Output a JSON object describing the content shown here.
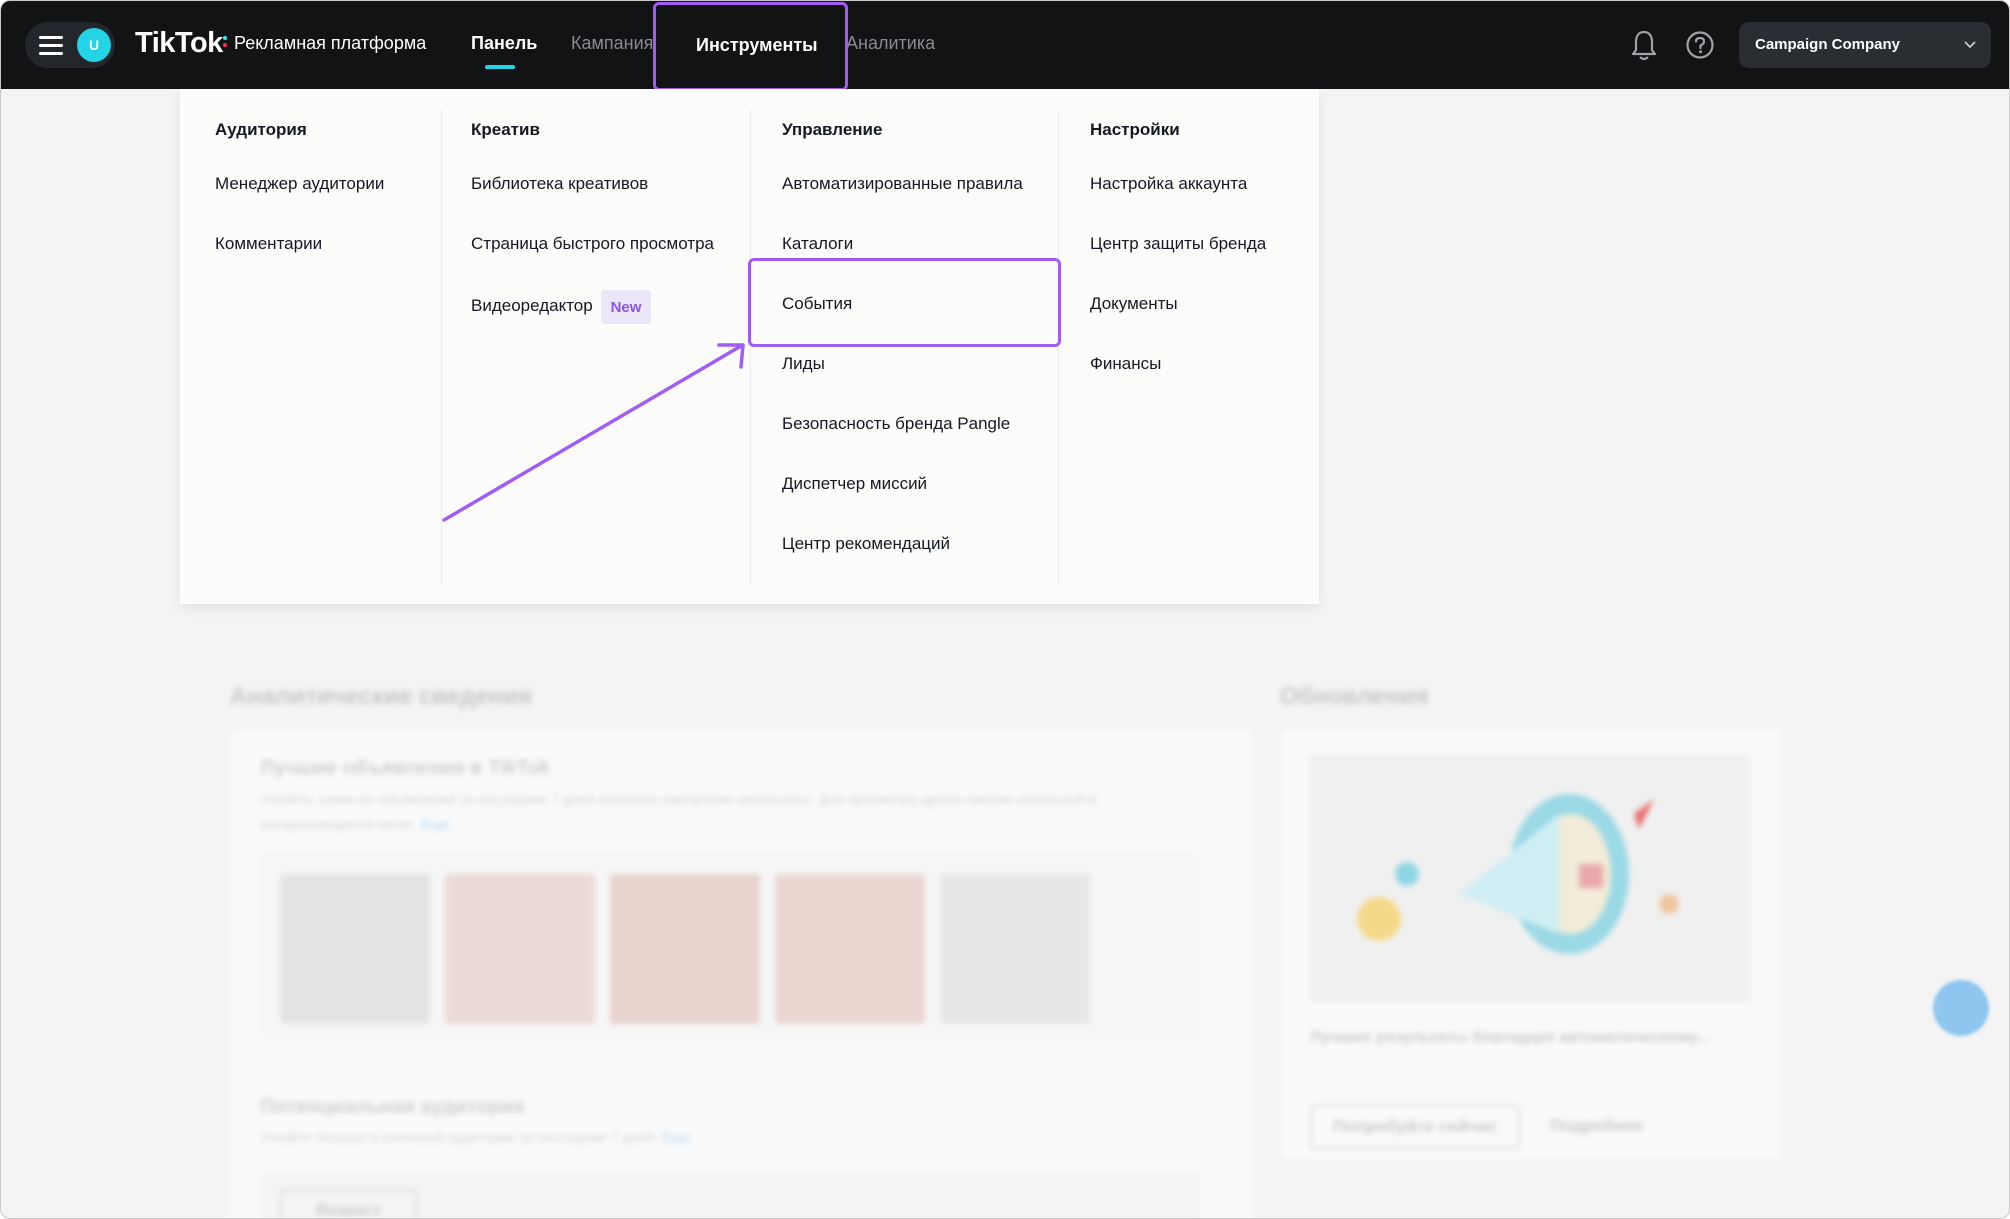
{
  "topbar": {
    "avatar_letter": "U",
    "logo": "TikTok",
    "logo_sub": "Рекламная платформа",
    "nav": [
      "Панель",
      "Кампания",
      "Инструменты",
      "Аналитика"
    ],
    "company": "Campaign Company",
    "accent": "#25d3e6",
    "highlight": "#a15cf5"
  },
  "menu": {
    "columns": [
      {
        "title": "Аудитория",
        "items": [
          "Менеджер аудитории",
          "Комментарии"
        ]
      },
      {
        "title": "Креатив",
        "items": [
          "Библиотека креативов",
          "Страница быстрого просмотра",
          "Видеоредактор"
        ],
        "badge": "New"
      },
      {
        "title": "Управление",
        "items": [
          "Автоматизированные правила",
          "Каталоги",
          "События",
          "Лиды",
          "Безопасность бренда Pangle",
          "Диспетчер миссий",
          "Центр рекомендаций"
        ]
      },
      {
        "title": "Настройки",
        "items": [
          "Настройка аккаунта",
          "Центр защиты бренда",
          "Документы",
          "Финансы"
        ]
      }
    ]
  },
  "background": {
    "analytics_title": "Аналитические сведения",
    "top_ads_title": "Лучшие объявления в TikTok",
    "top_ads_desc": "Узнайте, какие из объявлений за последние 7 дней показали наилучшие результаты. Для просмотра других метрик используйте раскрывающееся меню.",
    "more_link": "Еще",
    "audience_title": "Потенциальная аудитория",
    "audience_desc": "Узнайте больше о ключевой аудитории за последние 7 дней.",
    "age_dropdown": "Возраст",
    "updates_title": "Обновления",
    "update_caption": "Лучшие результаты благодаря автоматическому...",
    "try_button": "Попробуйте сейчас",
    "details_link": "Подробнее"
  }
}
